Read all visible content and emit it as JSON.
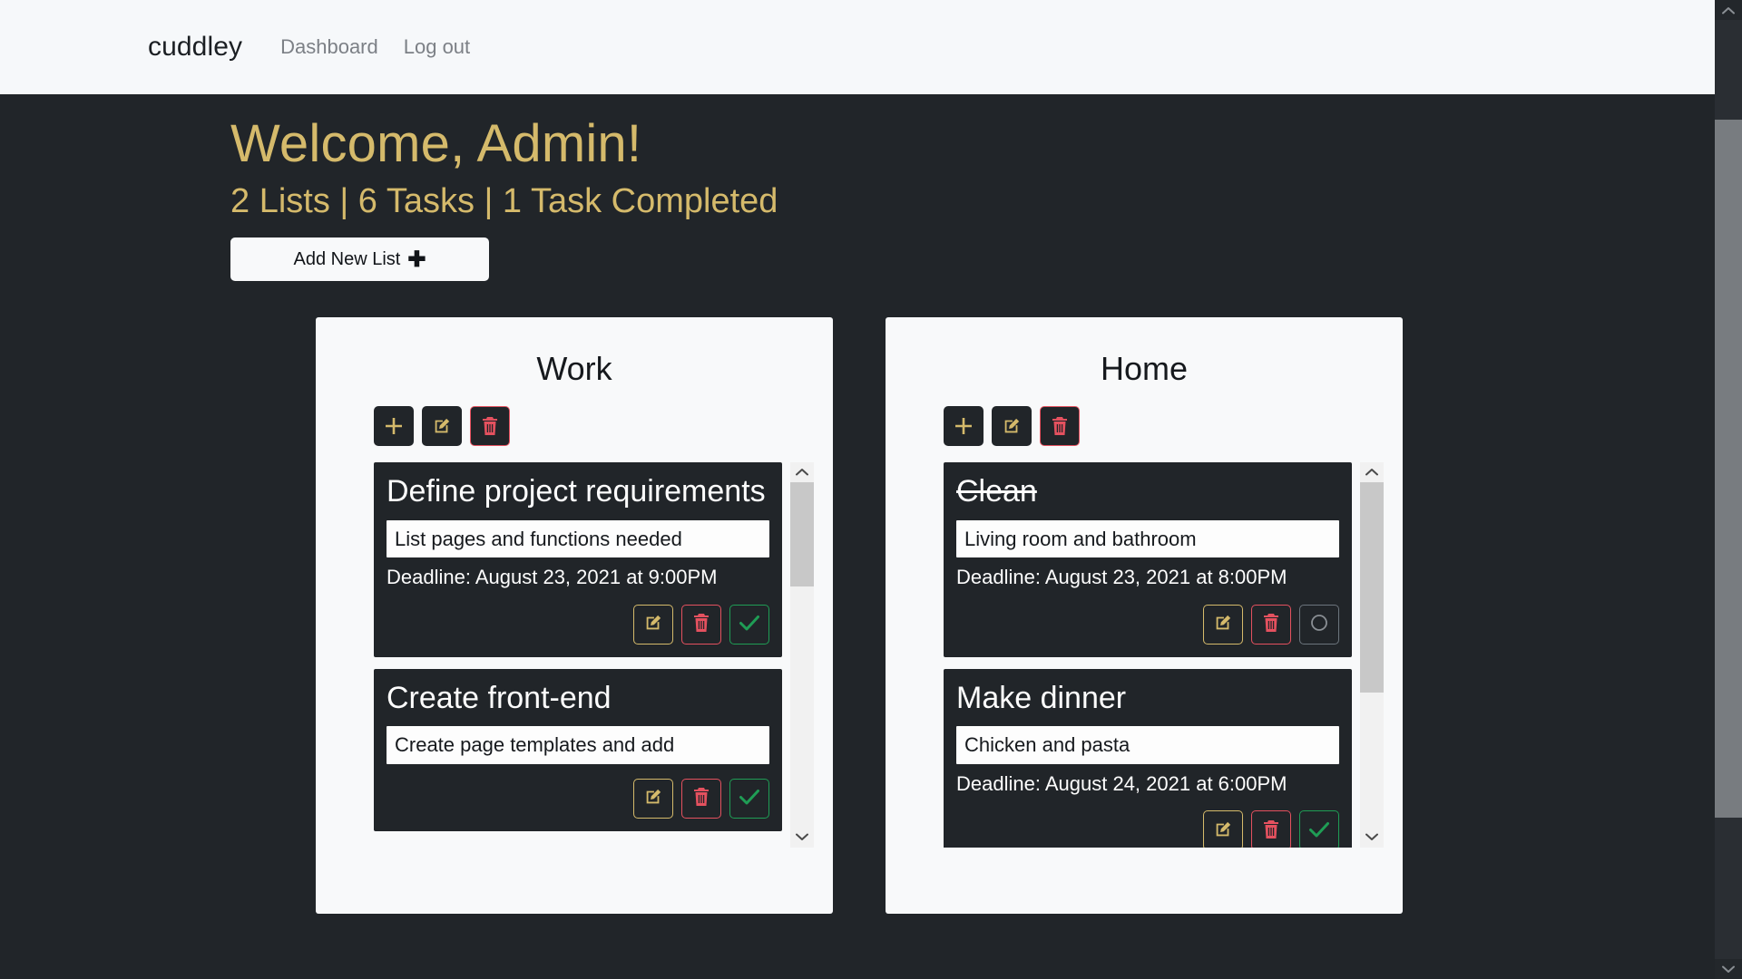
{
  "navbar": {
    "brand": "cuddley",
    "links": [
      {
        "label": "Dashboard"
      },
      {
        "label": "Log out"
      }
    ]
  },
  "hero": {
    "greeting": "Welcome, Admin!",
    "stats": "2 Lists | 6 Tasks | 1 Task Completed",
    "lists_count": 2,
    "tasks_count": 6,
    "tasks_completed": 1,
    "add_list_label": "Add New List",
    "add_list_icon": "plus-icon"
  },
  "colors": {
    "accent_gold": "#d5ba6b",
    "dark": "#212529",
    "light": "#f8f9fa",
    "danger": "#e4515f",
    "success": "#1f9d55",
    "muted": "#6c757d"
  },
  "list_toolbar": {
    "add_task_icon": "plus-icon",
    "edit_list_icon": "pencil-square-icon",
    "delete_list_icon": "trash-icon"
  },
  "task_actions": {
    "edit_icon": "pencil-square-icon",
    "delete_icon": "trash-icon",
    "complete_icon": "check-icon",
    "incomplete_icon": "circle-icon"
  },
  "lists": [
    {
      "title": "Work",
      "scroll": {
        "thumb_top": 0,
        "thumb_height": 115
      },
      "tasks": [
        {
          "title": "Define project requirements",
          "description": "List pages and functions needed",
          "deadline": "Deadline: August 23, 2021 at 9:00PM",
          "completed": false
        },
        {
          "title": "Create front-end",
          "description": "Create page templates and add",
          "deadline": "",
          "completed": false
        }
      ]
    },
    {
      "title": "Home",
      "scroll": {
        "thumb_top": 0,
        "thumb_height": 232
      },
      "tasks": [
        {
          "title": "Clean",
          "description": "Living room and bathroom",
          "deadline": "Deadline: August 23, 2021 at 8:00PM",
          "completed": true
        },
        {
          "title": "Make dinner",
          "description": "Chicken and pasta",
          "deadline": "Deadline: August 24, 2021 at 6:00PM",
          "completed": false
        }
      ]
    }
  ]
}
